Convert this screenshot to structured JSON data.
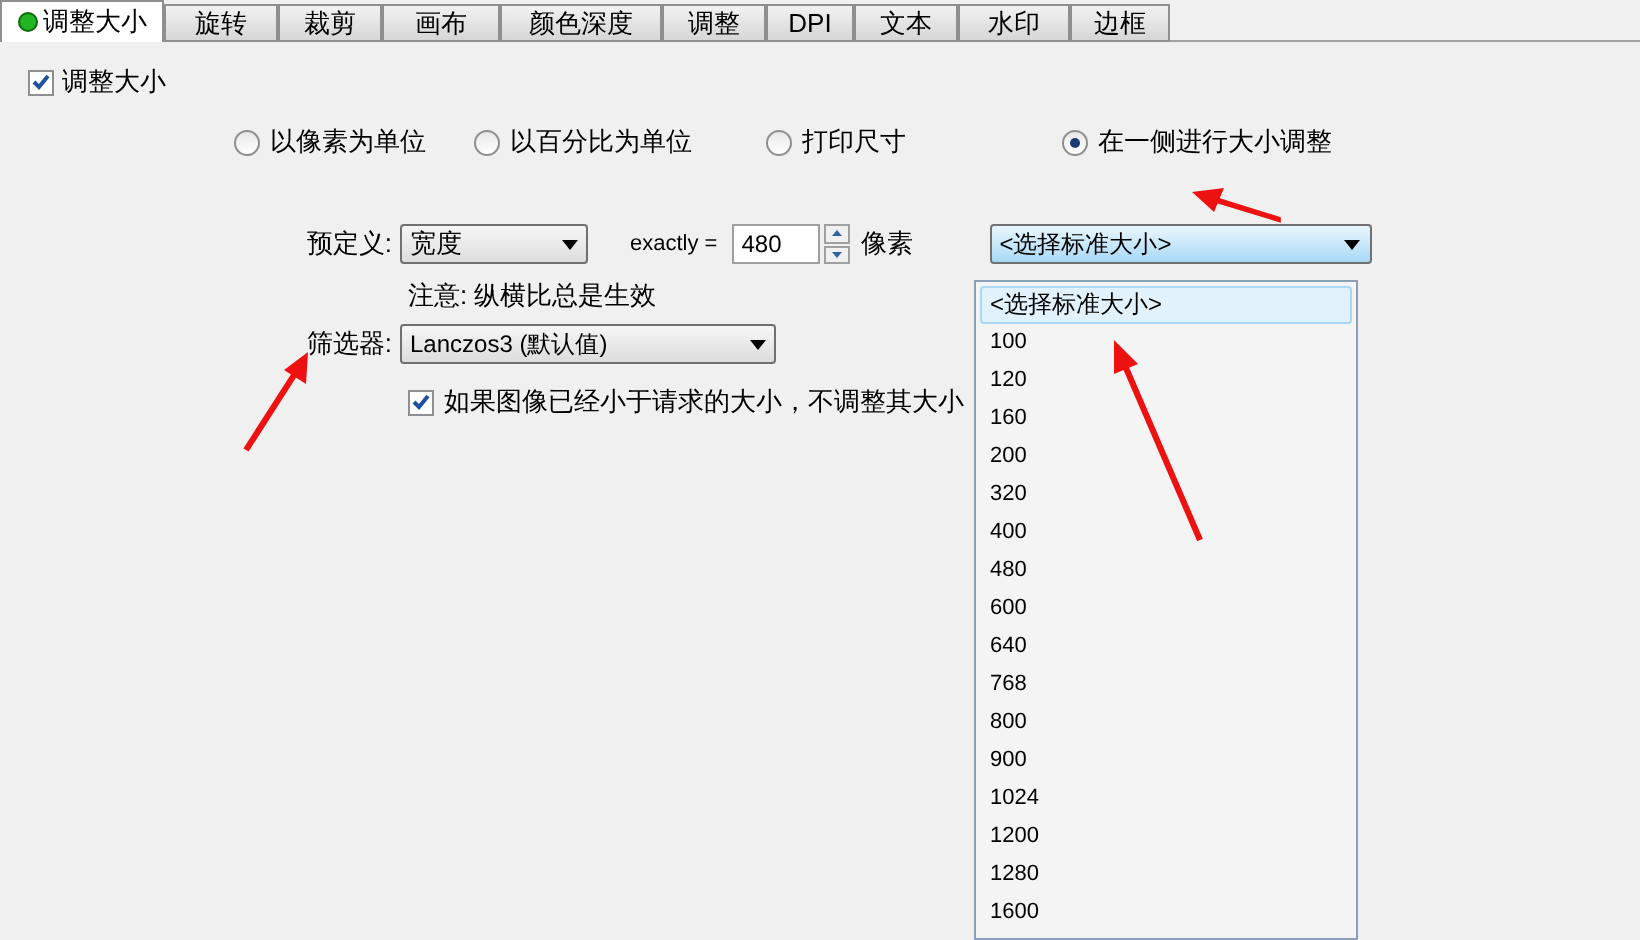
{
  "tabs": [
    {
      "label": "调整大小",
      "selected": true,
      "indicator": true
    },
    {
      "label": "旋转",
      "selected": false
    },
    {
      "label": "裁剪",
      "selected": false
    },
    {
      "label": "画布",
      "selected": false
    },
    {
      "label": "颜色深度",
      "selected": false
    },
    {
      "label": "调整",
      "selected": false
    },
    {
      "label": "DPI",
      "selected": false
    },
    {
      "label": "文本",
      "selected": false
    },
    {
      "label": "水印",
      "selected": false
    },
    {
      "label": "边框",
      "selected": false
    }
  ],
  "group": {
    "label": "调整大小",
    "checked": true
  },
  "modes": [
    {
      "label": "以像素为单位",
      "selected": false
    },
    {
      "label": "以百分比为单位",
      "selected": false
    },
    {
      "label": "打印尺寸",
      "selected": false
    },
    {
      "label": "在一侧进行大小调整",
      "selected": true
    }
  ],
  "predefined": {
    "label": "预定义:",
    "value": "宽度"
  },
  "exactly": {
    "label": "exactly =",
    "value": "480",
    "unit": "像素"
  },
  "note": "注意: 纵横比总是生效",
  "filter": {
    "label": "筛选器:",
    "value": "Lanczos3 (默认值)"
  },
  "skip_smaller": {
    "label": "如果图像已经小于请求的大小，不调整其大小",
    "checked": true
  },
  "standard_size": {
    "value": "<选择标准大小>",
    "expanded": true,
    "options": [
      {
        "label": "<选择标准大小>",
        "selected": true
      },
      {
        "label": "100",
        "selected": false
      },
      {
        "label": "120",
        "selected": false
      },
      {
        "label": "160",
        "selected": false
      },
      {
        "label": "200",
        "selected": false
      },
      {
        "label": "320",
        "selected": false
      },
      {
        "label": "400",
        "selected": false
      },
      {
        "label": "480",
        "selected": false
      },
      {
        "label": "600",
        "selected": false
      },
      {
        "label": "640",
        "selected": false
      },
      {
        "label": "768",
        "selected": false
      },
      {
        "label": "800",
        "selected": false
      },
      {
        "label": "900",
        "selected": false
      },
      {
        "label": "1024",
        "selected": false
      },
      {
        "label": "1200",
        "selected": false
      },
      {
        "label": "1280",
        "selected": false
      },
      {
        "label": "1600",
        "selected": false
      }
    ]
  }
}
